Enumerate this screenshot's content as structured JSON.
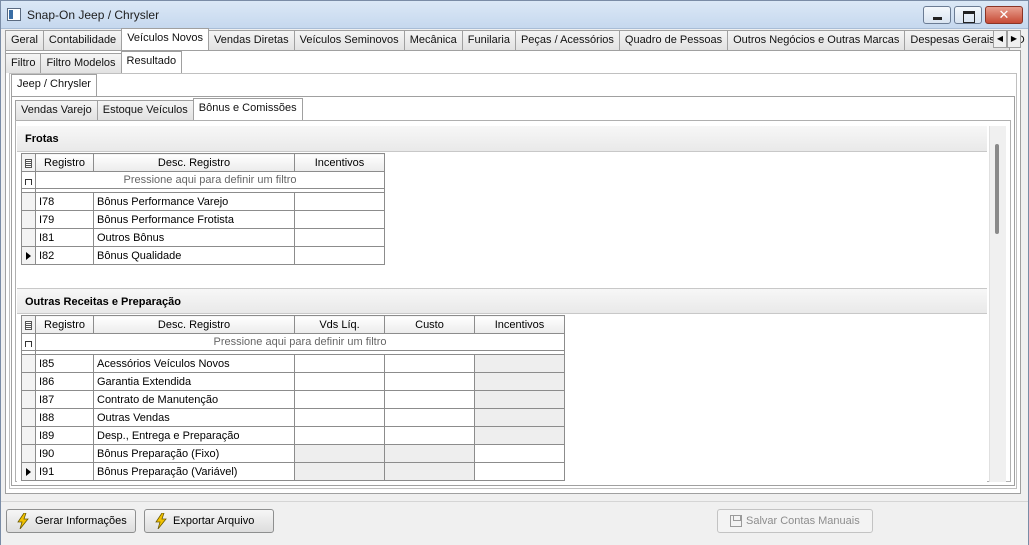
{
  "window": {
    "title": "Snap-On Jeep / Chrysler"
  },
  "main_tabs": [
    "Geral",
    "Contabilidade",
    "Veículos Novos",
    "Vendas Diretas",
    "Veículos Seminovos",
    "Mecânica",
    "Funilaria",
    "Peças / Acessórios",
    "Quadro de Pessoas",
    "Outros Negócios e Outras Marcas",
    "Despesas Gerais por D"
  ],
  "main_tabs_active": 2,
  "sub_tabs": [
    "Filtro",
    "Filtro Modelos",
    "Resultado"
  ],
  "sub_tabs_active": 2,
  "brand_tabs": [
    "Jeep / Chrysler"
  ],
  "inner_tabs": [
    "Vendas Varejo",
    "Estoque Veículos",
    "Bônus e Comissões"
  ],
  "inner_tabs_active": 2,
  "filter_hint": "Pressione aqui para definir um filtro",
  "frotas": {
    "title": "Frotas",
    "columns": [
      "Registro",
      "Desc. Registro",
      "Incentivos"
    ],
    "rows": [
      {
        "registro": "I78",
        "desc": "Bônus Performance Varejo",
        "incentivos": ""
      },
      {
        "registro": "I79",
        "desc": "Bônus Performance Frotista",
        "incentivos": ""
      },
      {
        "registro": "I81",
        "desc": "Outros Bônus",
        "incentivos": ""
      },
      {
        "registro": "I82",
        "desc": "Bônus Qualidade",
        "incentivos": ""
      }
    ]
  },
  "outras": {
    "title": "Outras Receitas e Preparação",
    "columns": [
      "Registro",
      "Desc. Registro",
      "Vds Líq.",
      "Custo",
      "Incentivos"
    ],
    "rows": [
      {
        "registro": "I85",
        "desc": "Acessórios Veículos Novos",
        "vds": "",
        "custo": "",
        "incentivos": ""
      },
      {
        "registro": "I86",
        "desc": "Garantia Extendida",
        "vds": "",
        "custo": "",
        "incentivos": ""
      },
      {
        "registro": "I87",
        "desc": "Contrato de Manutenção",
        "vds": "",
        "custo": "",
        "incentivos": ""
      },
      {
        "registro": "I88",
        "desc": "Outras Vendas",
        "vds": "",
        "custo": "",
        "incentivos": ""
      },
      {
        "registro": "I89",
        "desc": "Desp., Entrega e Preparação",
        "vds": "",
        "custo": "",
        "incentivos": ""
      },
      {
        "registro": "I90",
        "desc": "Bônus Preparação (Fixo)",
        "vds": "",
        "custo": "",
        "incentivos": ""
      },
      {
        "registro": "I91",
        "desc": "Bônus Preparação (Variável)",
        "vds": "",
        "custo": "",
        "incentivos": ""
      }
    ]
  },
  "buttons": {
    "gerar": "Gerar Informações",
    "exportar": "Exportar Arquivo",
    "salvar": "Salvar Contas Manuais"
  },
  "colors": {
    "accent_bolt": "#f2c200",
    "grid_border": "#8c8c8c",
    "disabled_cell": "#eeeeee"
  }
}
